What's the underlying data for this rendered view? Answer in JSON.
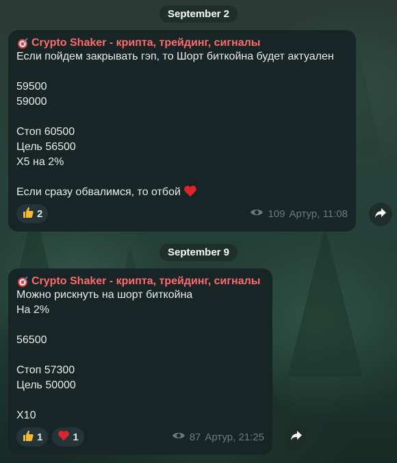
{
  "messages": [
    {
      "date": "September 2",
      "sender": "Crypto Shaker - крипта, трейдинг, сигналы",
      "lines": [
        "Если пойдем закрывать гэп, то Шорт биткойна будет актуален",
        "",
        "59500",
        "59000",
        "",
        "Стоп 60500",
        "Цель 56500",
        "Х5 на 2%",
        "",
        "Если сразу обвалимся, то отбой"
      ],
      "reactions": [
        {
          "icon": "thumbs-up-icon",
          "count": "2"
        }
      ],
      "views": "109",
      "author_time": "Артур, 11:08"
    },
    {
      "date": "September 9",
      "sender": "Crypto Shaker - крипта, трейдинг, сигналы",
      "lines": [
        "Можно рискнуть на шорт биткойна",
        "На 2%",
        "",
        "56500",
        "",
        "Стоп 57300",
        "Цель 50000",
        "",
        "Х10"
      ],
      "reactions": [
        {
          "icon": "thumbs-up-icon",
          "count": "1"
        },
        {
          "icon": "heart-icon",
          "count": "1"
        }
      ],
      "views": "87",
      "author_time": "Артур, 21:25"
    }
  ],
  "colors": {
    "sender": "#ff6b6b",
    "bubble": "#182526",
    "meta": "#6a7b7d",
    "heart": "#e0242b"
  }
}
